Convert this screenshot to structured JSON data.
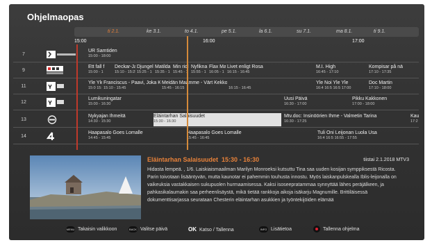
{
  "app": {
    "title": "Ohjelmaopas"
  },
  "days": [
    "ti 2.1.",
    "ke 3.1.",
    "to 4.1.",
    "pe 5.1.",
    "la 6.1.",
    "su 7.1.",
    "ma 8.1.",
    "ti 9.1."
  ],
  "selected_day": "ti 2.1.",
  "times": [
    "15:00",
    "16:00",
    "17:00"
  ],
  "channels": [
    {
      "number": "7",
      "logo_icon": "kutonen-logo-icon",
      "programs": [
        {
          "title": "UR Samtiden",
          "time": "15:00 - 18:00"
        }
      ]
    },
    {
      "number": "9",
      "logo_icon": "barn-kanalen-logo-icon",
      "programs": [
        {
          "title": "Ett fall f",
          "time": "15:00 - 1"
        },
        {
          "title": "Deckar-Jack",
          "time": "15:10 - 15:25"
        },
        {
          "title": "Djungel",
          "time": "15:25 - 1"
        },
        {
          "title": "Matilda",
          "time": "15:35 - 1"
        },
        {
          "title": "Min ridl",
          "time": "15:45 - 1"
        },
        {
          "title": "Nyfikna",
          "time": "15:55 - 1"
        },
        {
          "title": "Flax Ma",
          "time": "16:05 - 1"
        },
        {
          "title": "Livet enligt Rosa",
          "time": "16:15 - 16:45"
        },
        {
          "title": "M.I. High",
          "time": "16:45 - 17:10"
        },
        {
          "title": "Kompisar på nä",
          "time": "17:10 - 17:35"
        }
      ]
    },
    {
      "number": "11",
      "logo_icon": "yle-tv1-logo-icon",
      "programs": [
        {
          "title": "Yle Yle",
          "time": "15:0 15:0"
        },
        {
          "title": "Franciscus - Paavi, Joka Kosk",
          "time": "15:10 - 15:45"
        },
        {
          "title": "Meidän Maamme - Värt Kekkonen",
          "time": "15:45 - 16:15"
        },
        {
          "title": "",
          "time": "16:15 - 16:45"
        },
        {
          "title": "Yle Noi Yle Yle",
          "time": "16:4 16:5 16:5 17:00"
        },
        {
          "title": "Doc Martin",
          "time": "17:10 - 18:00"
        }
      ]
    },
    {
      "number": "12",
      "logo_icon": "yle-tv2-logo-icon",
      "programs": [
        {
          "title": "Lumikuningatar",
          "time": "15:00 - 16:30"
        },
        {
          "title": "Uusi Päivä",
          "time": "16:30 - 17:00"
        },
        {
          "title": "Pikku Kakkonen",
          "time": "17:00 - 18:00"
        }
      ]
    },
    {
      "number": "13",
      "logo_icon": "teema-fem-logo-icon",
      "programs": [
        {
          "title": "Nykyajan Ihmeitä",
          "time": "14:30 - 15:30"
        },
        {
          "title": "Eläintarhan Salaisuudet",
          "time": "15:30 - 16:30",
          "highlighted": true
        },
        {
          "title": "Mtv.doc: Insinöörien Ihme - Valmetin Tarina",
          "time": "16:30 - 17:25"
        },
        {
          "title": "Kau",
          "time": "17:2"
        }
      ]
    },
    {
      "number": "14",
      "logo_icon": "mtv-4-logo-icon",
      "programs": [
        {
          "title": "Haapasalo Goes Lomalle",
          "time": "14:45 - 15:45"
        },
        {
          "title": "Haapasalo Goes Lomalle",
          "time": "15:45 - 16:45"
        },
        {
          "title": "Tuli Oni Leijonan Luola Usa",
          "time": "16:4 16:5 16:55 - 17:55"
        }
      ]
    }
  ],
  "detail": {
    "title": "Eläintarhan Salaisuudet",
    "time": "15:30 - 16:30",
    "date_channel": "tiistai 2.1.2018 MTV3",
    "description": "Hidasta lempeä. , 1/6. Laiskiaismaailman Marilyn Monroeksi kutsuttu Tina saa uuden kosijan sympp­iksestä Ricosta. Parin toivotaan lisääntyvän, mutta kaunotar ei pahemmin touhusta innostu. Myös laiskanpulskealla Iblis-leijonalla on vaikeuksia vastakkaisen sukupuolen hurmaamisessa. Kaksi isoseepratammaa synnyttää lähes peräjälkeen, ja pahkasikalaumakin saa perheenlisäystä, mikä tietää rankkoja aikoja isäkarju Magnumille. Brittiläisessä dokumenttisarjassa seurataan Chesterin eläintarhan asukkien ja työntekijöiden elämää"
  },
  "footer": {
    "back": {
      "badge": "MENU",
      "label": "Takaisin valikkoon"
    },
    "day": {
      "badge": "BACK",
      "label": "Valitse päivä"
    },
    "ok": {
      "badge": "OK",
      "label": "Katso / Tallenna"
    },
    "info": {
      "badge": "INFO",
      "label": "Lisätietoa"
    },
    "rec": {
      "label": "Tallenna ohjelma"
    }
  },
  "colors": {
    "accent": "#e8823a",
    "now_line": "#d58a3a",
    "start_line": "#c0392b",
    "highlight": "#e1e1e1"
  }
}
